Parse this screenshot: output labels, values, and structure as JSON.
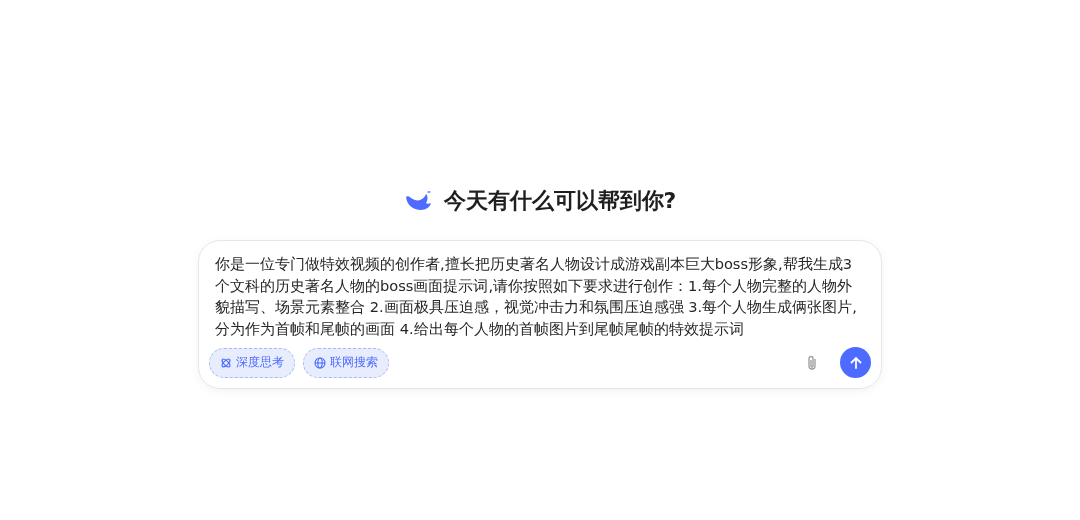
{
  "greeting": "今天有什么可以帮到你?",
  "composer": {
    "value": "你是一位专门做特效视频的创作者,擅长把历史著名人物设计成游戏副本巨大boss形象,帮我生成3个文科的历史著名人物的boss画面提示词,请你按照如下要求进行创作：1.每个人物完整的人物外貌描写、场景元素整合 2.画面极具压迫感，视觉冲击力和氛围压迫感强 3.每个人物生成俩张图片,分为作为首帧和尾帧的画面 4.给出每个人物的首帧图片到尾帧尾帧的特效提示词",
    "toggles": [
      {
        "kind": "think",
        "label": "深度思考",
        "selected": true
      },
      {
        "kind": "search",
        "label": "联网搜索",
        "selected": true
      }
    ]
  }
}
